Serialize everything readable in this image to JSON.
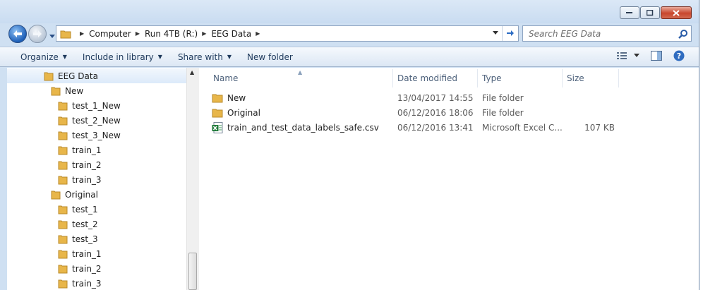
{
  "window": {
    "controls": {
      "minimize_icon": "minimize-icon",
      "maximize_icon": "maximize-icon",
      "close_icon": "close-icon"
    }
  },
  "address": {
    "crumbs": [
      "Computer",
      "Run 4TB (R:)",
      "EEG Data"
    ],
    "search_placeholder": "Search EEG Data"
  },
  "toolbar": {
    "organize": "Organize",
    "include_in_library": "Include in library",
    "share_with": "Share with",
    "new_folder": "New folder"
  },
  "nav_tree": [
    {
      "label": "EEG Data",
      "selected": true
    },
    {
      "label": "New"
    },
    {
      "label": "test_1_New"
    },
    {
      "label": "test_2_New"
    },
    {
      "label": "test_3_New"
    },
    {
      "label": "train_1"
    },
    {
      "label": "train_2"
    },
    {
      "label": "train_3"
    },
    {
      "label": "Original"
    },
    {
      "label": "test_1"
    },
    {
      "label": "test_2"
    },
    {
      "label": "test_3"
    },
    {
      "label": "train_1"
    },
    {
      "label": "train_2"
    },
    {
      "label": "train_3"
    }
  ],
  "columns": {
    "name": "Name",
    "date": "Date modified",
    "type": "Type",
    "size": "Size"
  },
  "files": [
    {
      "name": "New",
      "date": "13/04/2017 14:55",
      "type": "File folder",
      "size": "",
      "icon": "folder-icon"
    },
    {
      "name": "Original",
      "date": "06/12/2016 18:06",
      "type": "File folder",
      "size": "",
      "icon": "folder-icon"
    },
    {
      "name": "train_and_test_data_labels_safe.csv",
      "date": "06/12/2016 13:41",
      "type": "Microsoft Excel C...",
      "size": "107 KB",
      "icon": "excel-file-icon"
    }
  ],
  "colors": {
    "accent": "#1d5fb8",
    "toolbar_text": "#1e395b",
    "folder": "#e8b64a"
  }
}
